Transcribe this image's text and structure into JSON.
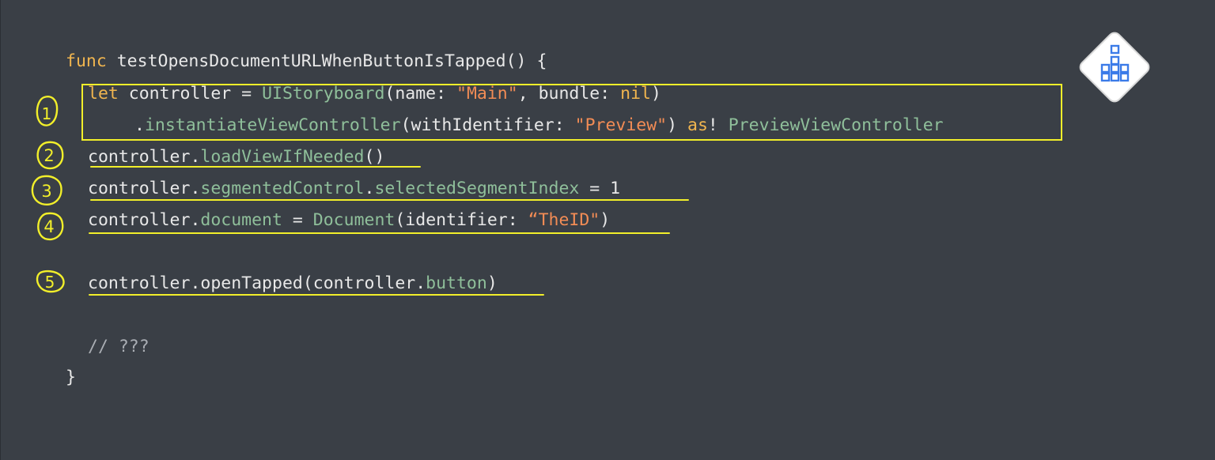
{
  "code_lines": [
    [
      {
        "t": "func ",
        "c": "kw"
      },
      {
        "t": "testOpensDocumentURLWhenButtonIsTapped() {",
        "c": "fn"
      }
    ],
    [
      {
        "t": "let ",
        "c": "kw"
      },
      {
        "t": "controller = ",
        "c": "fn"
      },
      {
        "t": "UIStoryboard",
        "c": "ty"
      },
      {
        "t": "(name: ",
        "c": "fn"
      },
      {
        "t": "\"Main\"",
        "c": "str"
      },
      {
        "t": ", bundle: ",
        "c": "fn"
      },
      {
        "t": "nil",
        "c": "kw"
      },
      {
        "t": ")",
        "c": "fn"
      }
    ],
    [
      {
        "t": ".",
        "c": "fn"
      },
      {
        "t": "instantiateViewController",
        "c": "mem"
      },
      {
        "t": "(withIdentifier: ",
        "c": "fn"
      },
      {
        "t": "\"Preview\"",
        "c": "str"
      },
      {
        "t": ") ",
        "c": "fn"
      },
      {
        "t": "as",
        "c": "kw"
      },
      {
        "t": "! ",
        "c": "fn"
      },
      {
        "t": "PreviewViewController",
        "c": "ty"
      }
    ],
    [
      {
        "t": "controller.",
        "c": "fn"
      },
      {
        "t": "loadViewIfNeeded",
        "c": "mem"
      },
      {
        "t": "()",
        "c": "fn"
      }
    ],
    [
      {
        "t": "controller.",
        "c": "fn"
      },
      {
        "t": "segmentedControl",
        "c": "mem"
      },
      {
        "t": ".",
        "c": "fn"
      },
      {
        "t": "selectedSegmentIndex",
        "c": "mem"
      },
      {
        "t": " = 1",
        "c": "num"
      }
    ],
    [
      {
        "t": "controller.",
        "c": "fn"
      },
      {
        "t": "document",
        "c": "mem"
      },
      {
        "t": " = ",
        "c": "fn"
      },
      {
        "t": "Document",
        "c": "ty"
      },
      {
        "t": "(identifier: ",
        "c": "fn"
      },
      {
        "t": "“TheID\"",
        "c": "str"
      },
      {
        "t": ")",
        "c": "fn"
      }
    ],
    [
      {
        "t": "controller.openTapped(controller.",
        "c": "fn"
      },
      {
        "t": "button",
        "c": "mem"
      },
      {
        "t": ")",
        "c": "fn"
      }
    ],
    [
      {
        "t": "// ???",
        "c": "cm"
      }
    ],
    [
      {
        "t": "}",
        "c": "fn"
      }
    ]
  ],
  "colors": {
    "background": "#3a3f46",
    "keyword": "#f0b54f",
    "type": "#8fbf9a",
    "string": "#f28c55",
    "plain": "#e8e8e8",
    "comment": "#a9adb3",
    "annotation": "#f2ef2a",
    "logo": "#3b7be8"
  },
  "annotations": {
    "step_numbers": [
      "1",
      "2",
      "3",
      "4",
      "5"
    ]
  },
  "logo": {
    "icon": "building-blocks-icon"
  }
}
